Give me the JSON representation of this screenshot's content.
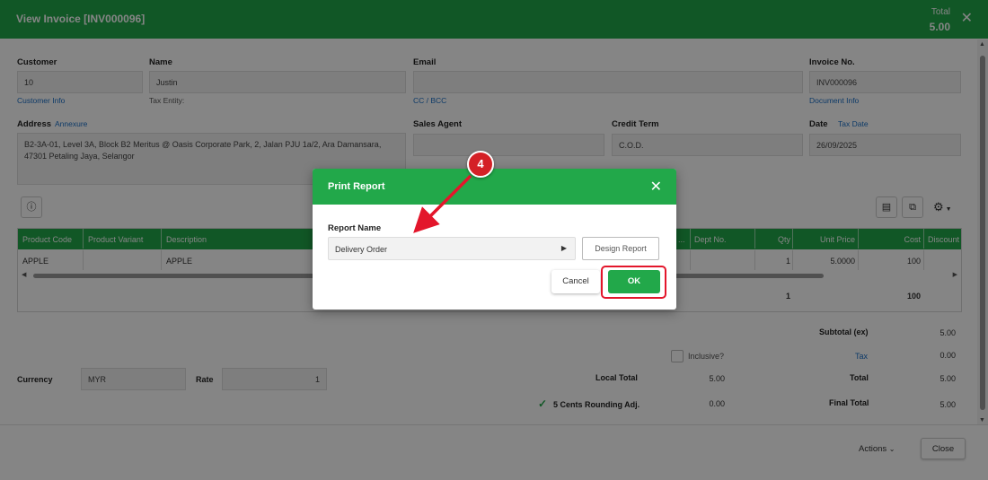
{
  "window": {
    "title": "View Invoice [INV000096]",
    "total_label": "Total",
    "total_value": "5.00"
  },
  "form": {
    "customer_label": "Customer",
    "customer_value": "10",
    "customer_info_link": "Customer Info",
    "name_label": "Name",
    "name_value": "Justin",
    "tax_entity_label": "Tax Entity:",
    "email_label": "Email",
    "email_value": "",
    "cc_bcc_link": "CC / BCC",
    "invoice_no_label": "Invoice No.",
    "invoice_no_value": "INV000096",
    "document_info_link": "Document Info",
    "address_label": "Address",
    "annexure_link": "Annexure",
    "address_line1": "B2-3A-01, Level 3A, Block B2 Meritus @ Oasis Corporate Park, 2, Jalan PJU 1a/2, Ara Damansara,",
    "address_line2": "47301 Petaling Jaya, Selangor",
    "sales_agent_label": "Sales Agent",
    "sales_agent_value": "",
    "credit_term_label": "Credit Term",
    "credit_term_value": "C.O.D.",
    "date_label": "Date",
    "tax_date_link": "Tax Date",
    "date_value": "26/09/2025"
  },
  "grid": {
    "headers": [
      "Product Code",
      "Product Variant",
      "Description",
      "...",
      "Dept No.",
      "Qty",
      "Unit Price",
      "Cost",
      "Discount"
    ],
    "row": {
      "product_code": "APPLE",
      "description": "APPLE",
      "qty": "1",
      "unit_price": "5.0000",
      "cost": "100"
    },
    "total_qty": "1",
    "total_cost": "100"
  },
  "summary": {
    "subtotal_label": "Subtotal (ex)",
    "subtotal_value": "5.00",
    "inclusive_label": "Inclusive?",
    "tax_label": "Tax",
    "tax_value": "0.00",
    "local_total_label": "Local Total",
    "local_total_value": "5.00",
    "total_label": "Total",
    "total_value": "5.00",
    "rounding_label": "5 Cents Rounding Adj.",
    "rounding_value": "0.00",
    "final_total_label": "Final Total",
    "final_total_value": "5.00",
    "currency_label": "Currency",
    "currency_value": "MYR",
    "rate_label": "Rate",
    "rate_value": "1"
  },
  "footer": {
    "actions_label": "Actions",
    "close_label": "Close"
  },
  "modal": {
    "title": "Print Report",
    "report_name_label": "Report Name",
    "report_name_value": "Delivery Order",
    "design_report_label": "Design Report",
    "cancel_label": "Cancel",
    "ok_label": "OK"
  },
  "annotation": {
    "step_number": "4",
    "highlight_color": "#e3162b"
  },
  "colors": {
    "brand_green": "#22a84a",
    "link_blue": "#1a6fc7"
  }
}
